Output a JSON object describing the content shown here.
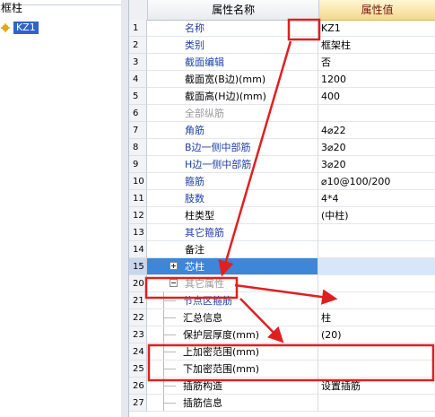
{
  "tree": {
    "title": "框柱",
    "selected_item": "KZ1",
    "item_icon": "gear-icon"
  },
  "grid": {
    "headers": {
      "name": "属性名称",
      "value": "属性值"
    },
    "rows": [
      {
        "num": "1",
        "name": "名称",
        "value": "KZ1",
        "style": "blue"
      },
      {
        "num": "2",
        "name": "类别",
        "value": "框架柱",
        "style": "blue"
      },
      {
        "num": "3",
        "name": "截面编辑",
        "value": "否",
        "style": "blue"
      },
      {
        "num": "4",
        "name": "截面宽(B边)(mm)",
        "value": "1200",
        "style": "plain"
      },
      {
        "num": "5",
        "name": "截面高(H边)(mm)",
        "value": "400",
        "style": "plain"
      },
      {
        "num": "6",
        "name": "全部纵筋",
        "value": "",
        "style": "gray"
      },
      {
        "num": "7",
        "name": "角筋",
        "value": "4⌀22",
        "style": "blue"
      },
      {
        "num": "8",
        "name": "B边一侧中部筋",
        "value": "3⌀20",
        "style": "blue"
      },
      {
        "num": "9",
        "name": "H边一侧中部筋",
        "value": "3⌀20",
        "style": "blue"
      },
      {
        "num": "10",
        "name": "箍筋",
        "value": "⌀10@100/200",
        "style": "blue"
      },
      {
        "num": "11",
        "name": "肢数",
        "value": "4*4",
        "style": "blue"
      },
      {
        "num": "12",
        "name": "柱类型",
        "value": "(中柱)",
        "style": "plain"
      },
      {
        "num": "13",
        "name": "其它箍筋",
        "value": "",
        "style": "blue"
      },
      {
        "num": "14",
        "name": "备注",
        "value": "",
        "style": "plain"
      },
      {
        "num": "15",
        "name": "芯柱",
        "value": "",
        "style": "selected",
        "expander": "plus"
      },
      {
        "num": "20",
        "name": "其它属性",
        "value": "",
        "style": "gray",
        "expander": "minus"
      },
      {
        "num": "21",
        "name": "节点区箍筋",
        "value": "",
        "style": "sub-blue"
      },
      {
        "num": "22",
        "name": "汇总信息",
        "value": "柱",
        "style": "sub"
      },
      {
        "num": "23",
        "name": "保护层厚度(mm)",
        "value": "(20)",
        "style": "sub"
      },
      {
        "num": "24",
        "name": "上加密范围(mm)",
        "value": "",
        "style": "sub"
      },
      {
        "num": "25",
        "name": "下加密范围(mm)",
        "value": "",
        "style": "sub"
      },
      {
        "num": "26",
        "name": "插筋构造",
        "value": "设置插筋",
        "style": "sub"
      },
      {
        "num": "27",
        "name": "插筋信息",
        "value": "",
        "style": "sub"
      }
    ]
  },
  "annotations": {
    "color": "#e02020"
  }
}
